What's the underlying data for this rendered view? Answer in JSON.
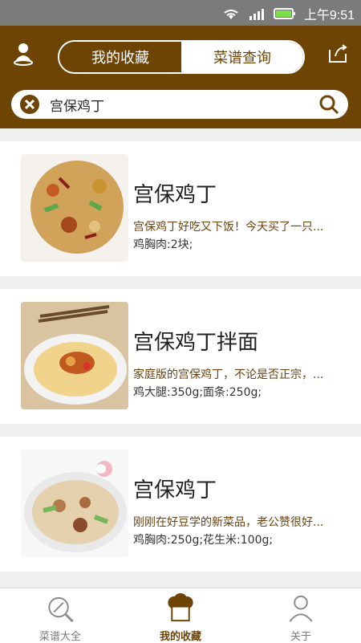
{
  "status_bar": {
    "time": "上午9:51",
    "icons": [
      "wifi-icon",
      "signal-icon",
      "battery-icon"
    ]
  },
  "header": {
    "tabs": [
      {
        "label": "我的收藏",
        "active": true
      },
      {
        "label": "菜谱查询",
        "active": false
      }
    ],
    "search": {
      "value": "宫保鸡丁",
      "placeholder": ""
    },
    "colors": {
      "brand": "#6e4405"
    }
  },
  "recipes": [
    {
      "title": "宫保鸡丁",
      "desc": "宫保鸡丁好吃又下饭！今天买了一只...",
      "ingredients": "鸡胸肉:2块;"
    },
    {
      "title": "宫保鸡丁拌面",
      "desc": "家庭版的宫保鸡丁，不论是否正宗，...",
      "ingredients": "鸡大腿:350g;面条:250g;"
    },
    {
      "title": "宫保鸡丁",
      "desc": "刚刚在好豆学的新菜品，老公赞很好...",
      "ingredients": "鸡胸肉:250g;花生米:100g;"
    }
  ],
  "bottom_nav": [
    {
      "label": "菜谱大全",
      "active": false
    },
    {
      "label": "我的收藏",
      "active": true
    },
    {
      "label": "关于",
      "active": false
    }
  ]
}
